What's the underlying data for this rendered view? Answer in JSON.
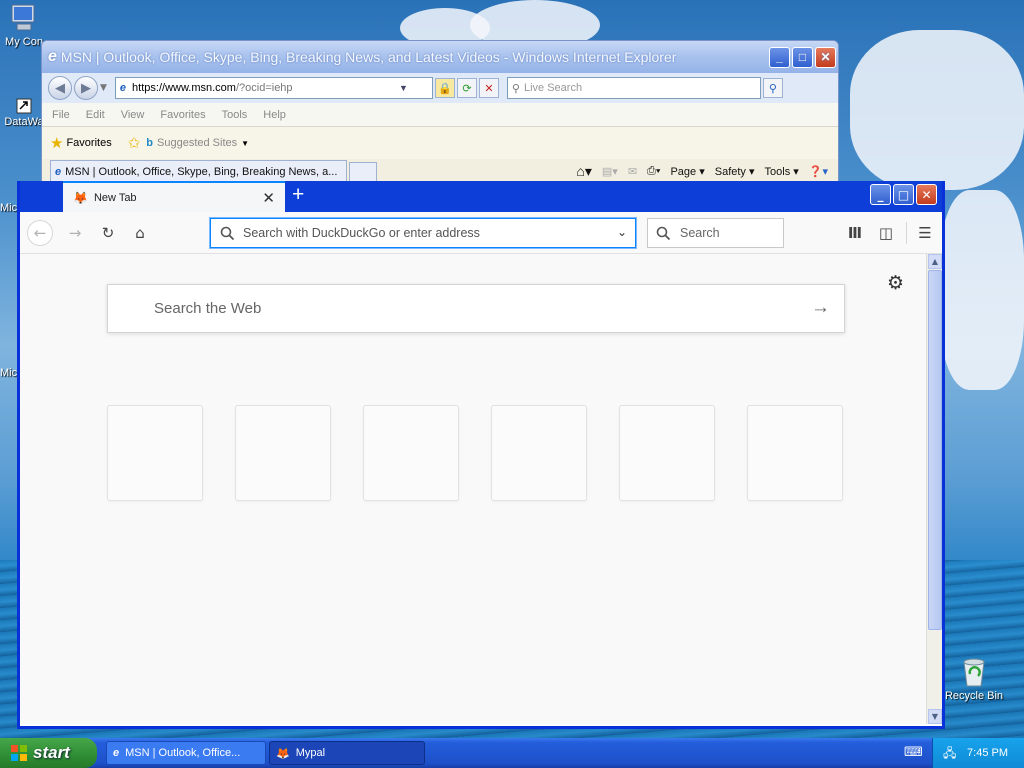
{
  "desktop": {
    "icons": [
      {
        "label": "My Con"
      },
      {
        "label": "DataWa"
      },
      {
        "label": "Mic"
      },
      {
        "label": "Mic"
      },
      {
        "label": "Recycle Bin"
      }
    ]
  },
  "ie": {
    "title": "MSN | Outlook, Office, Skype, Bing, Breaking News, and Latest Videos - Windows Internet Explorer",
    "address_prefix": "https://www.msn.com",
    "address_rest": "/?ocid=iehp",
    "live_search_placeholder": "Live Search",
    "menu": [
      "File",
      "Edit",
      "View",
      "Favorites",
      "Tools",
      "Help"
    ],
    "favorites_label": "Favorites",
    "suggested_sites": "Suggested Sites",
    "tab_title": "MSN | Outlook, Office, Skype, Bing, Breaking News, a...",
    "commands": {
      "page": "Page",
      "safety": "Safety",
      "tools": "Tools"
    }
  },
  "firefox": {
    "tab_title": "New Tab",
    "url_placeholder": "Search with DuckDuckGo or enter address",
    "search_placeholder": "Search",
    "web_search_placeholder": "Search the Web",
    "tile_count": 6
  },
  "taskbar": {
    "start_label": "start",
    "tasks": [
      {
        "label": "MSN | Outlook, Office..."
      },
      {
        "label": "Mypal"
      }
    ],
    "clock": "7:45 PM"
  },
  "colors": {
    "xp_blue": "#0831d9",
    "ff_accent": "#0a84ff",
    "start_green": "#2f8d33"
  }
}
